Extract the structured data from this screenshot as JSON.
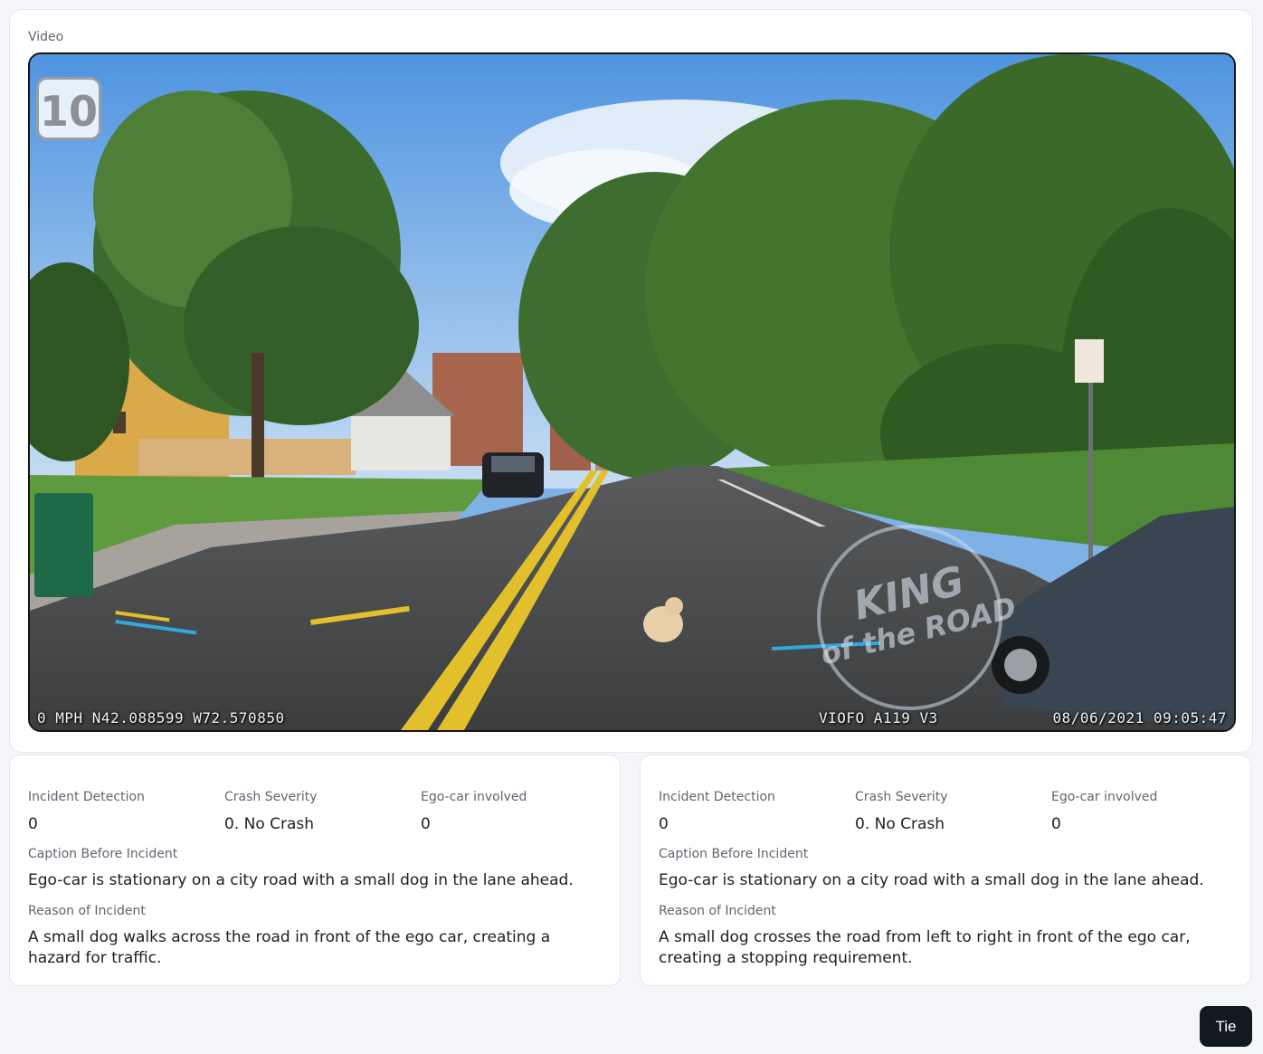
{
  "video": {
    "label": "Video",
    "speed_badge": "10",
    "overlay_left": "0 MPH N42.088599 W72.570850",
    "overlay_middle": "VIOFO A119 V3",
    "overlay_right": "08/06/2021 09:05:47",
    "watermark_line1": "KING",
    "watermark_line2": "of the ROAD"
  },
  "results": [
    {
      "incident_detection_label": "Incident Detection",
      "incident_detection_value": "0",
      "crash_severity_label": "Crash Severity",
      "crash_severity_value": "0. No Crash",
      "ego_involved_label": "Ego-car involved",
      "ego_involved_value": "0",
      "caption_label": "Caption Before Incident",
      "caption_value": "Ego-car is stationary on a city road with a small dog in the lane ahead.",
      "reason_label": "Reason of Incident",
      "reason_value": "A small dog walks across the road in front of the ego car, creating a hazard for traffic."
    },
    {
      "incident_detection_label": "Incident Detection",
      "incident_detection_value": "0",
      "crash_severity_label": "Crash Severity",
      "crash_severity_value": "0. No Crash",
      "ego_involved_label": "Ego-car involved",
      "ego_involved_value": "0",
      "caption_label": "Caption Before Incident",
      "caption_value": "Ego-car is stationary on a city road with a small dog in the lane ahead.",
      "reason_label": "Reason of Incident",
      "reason_value": "A small dog crosses the road from left to right in front of the ego car, creating a stopping requirement."
    }
  ],
  "tie_button_label": "Tie"
}
